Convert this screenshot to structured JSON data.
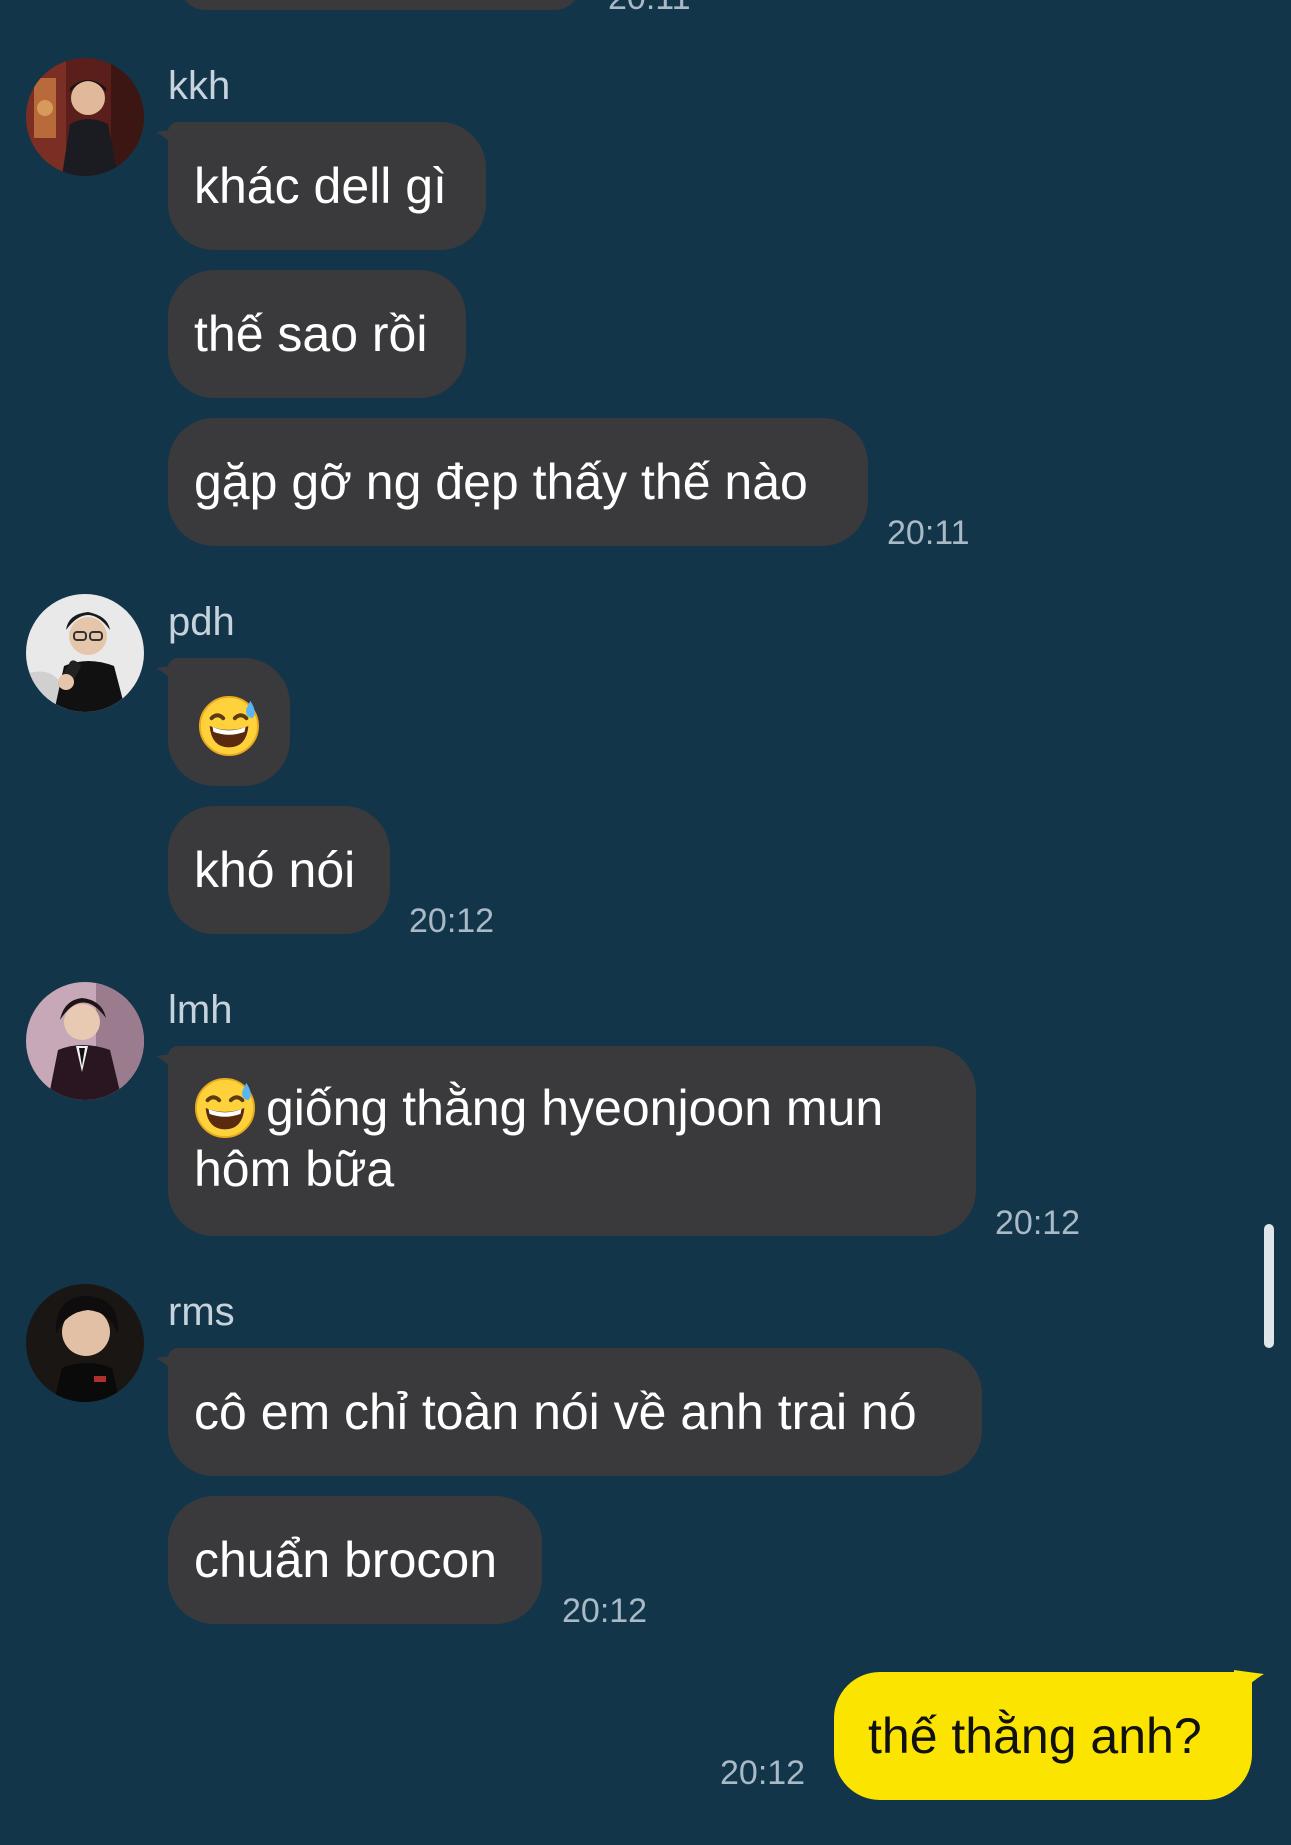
{
  "top_cut": {
    "time": "20:11"
  },
  "groups": [
    {
      "sender": "kkh",
      "avatar_icon": "avatar-kkh",
      "messages": [
        "khác dell gì",
        "thế sao rồi",
        "gặp gỡ ng đẹp thấy thế nào"
      ],
      "time": "20:11"
    },
    {
      "sender": "pdh",
      "avatar_icon": "avatar-pdh",
      "messages": [
        "😅",
        "khó nói"
      ],
      "time": "20:12"
    },
    {
      "sender": "lmh",
      "avatar_icon": "avatar-lmh",
      "messages": [
        "giống thằng hyeonjoon mun hôm bữa"
      ],
      "message_lines": [
        "giống thằng hyeonjoon mun",
        "hôm bữa"
      ],
      "emoji_icon": "sweat-smile-emoji-icon",
      "time": "20:12"
    },
    {
      "sender": "rms",
      "avatar_icon": "avatar-rms",
      "messages": [
        "cô em chỉ toàn nói về anh trai nó",
        "chuẩn brocon"
      ],
      "time": "20:12"
    }
  ],
  "own_message": {
    "text": "thế thằng anh?",
    "time": "20:12"
  },
  "colors": {
    "background": "#12354a",
    "incoming_bubble": "#3a3a3c",
    "outgoing_bubble": "#fbe400"
  }
}
